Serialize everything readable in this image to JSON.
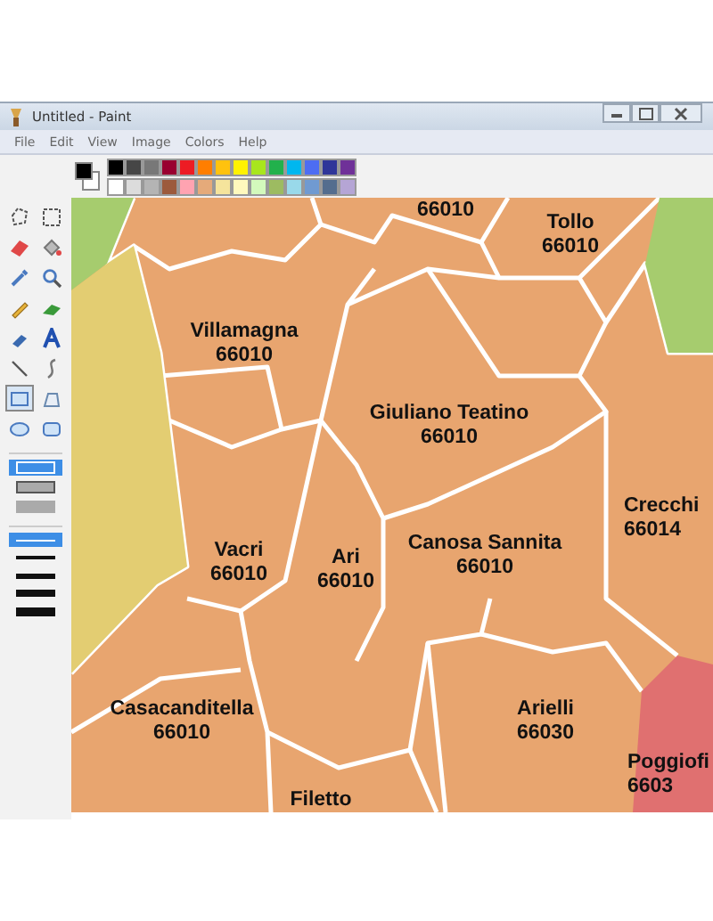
{
  "window": {
    "title": "Untitled - Paint"
  },
  "menu": [
    "File",
    "Edit",
    "View",
    "Image",
    "Colors",
    "Help"
  ],
  "tools": [
    {
      "selected": false
    },
    {
      "selected": false
    },
    {
      "selected": false
    },
    {
      "selected": false
    },
    {
      "selected": false
    },
    {
      "selected": false
    },
    {
      "selected": false
    },
    {
      "selected": false
    },
    {
      "selected": false
    },
    {
      "selected": false
    },
    {
      "selected": false
    },
    {
      "selected": false
    },
    {
      "selected": true
    },
    {
      "selected": false
    },
    {
      "selected": false
    },
    {
      "selected": false
    }
  ],
  "fill_styles": [
    {
      "selected": true
    },
    {
      "selected": false
    },
    {
      "selected": false
    }
  ],
  "line_widths": [
    {
      "selected": true
    },
    {
      "selected": false
    },
    {
      "selected": false
    },
    {
      "selected": false
    },
    {
      "selected": false
    }
  ],
  "palette": [
    {
      "color": "#000000"
    },
    {
      "color": "#464646"
    },
    {
      "color": "#787878"
    },
    {
      "color": "#990030"
    },
    {
      "color": "#ed1c24"
    },
    {
      "color": "#ff7e00"
    },
    {
      "color": "#ffc20e"
    },
    {
      "color": "#fff200"
    },
    {
      "color": "#a8e61d"
    },
    {
      "color": "#22b14c"
    },
    {
      "color": "#00b7ef"
    },
    {
      "color": "#4d6df3"
    },
    {
      "color": "#2f3699"
    },
    {
      "color": "#6f3198"
    },
    {
      "color": "#ffffff"
    },
    {
      "color": "#dcdcdc"
    },
    {
      "color": "#b4b4b4"
    },
    {
      "color": "#9c5a3c"
    },
    {
      "color": "#ffa3b1"
    },
    {
      "color": "#e5aa7a"
    },
    {
      "color": "#f5e49c"
    },
    {
      "color": "#fff9bd"
    },
    {
      "color": "#d3f9bc"
    },
    {
      "color": "#9dbb61"
    },
    {
      "color": "#99d9ea"
    },
    {
      "color": "#709ad1"
    },
    {
      "color": "#546d8e"
    },
    {
      "color": "#b5a5d5"
    }
  ],
  "map_labels": [
    {
      "code": "66010"
    },
    {
      "name": "Tollo",
      "code": "66010"
    },
    {
      "name": "Villamagna",
      "code": "66010"
    },
    {
      "name": "Giuliano Teatino",
      "code": "66010"
    },
    {
      "name": "Crecchi",
      "code": "66014"
    },
    {
      "name": "Vacri",
      "code": "66010"
    },
    {
      "name": "Ari",
      "code": "66010"
    },
    {
      "name": "Canosa Sannita",
      "code": "66010"
    },
    {
      "name": "Casacanditella",
      "code": "66010"
    },
    {
      "name": "Arielli",
      "code": "66030"
    },
    {
      "name": "Poggiofi",
      "code": "6603"
    },
    {
      "name": "Filetto"
    }
  ]
}
